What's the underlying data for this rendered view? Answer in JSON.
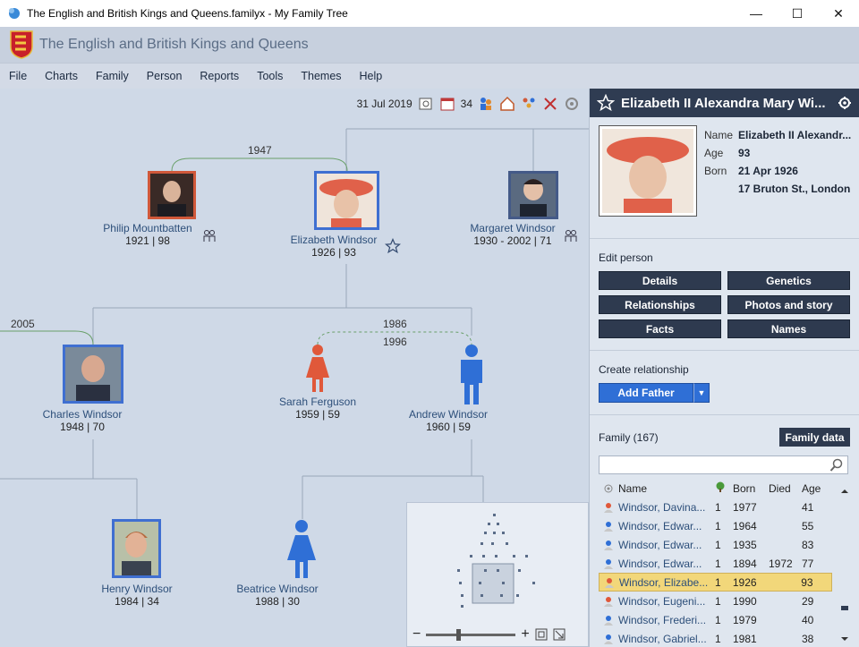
{
  "window": {
    "title": "The English and British Kings and Queens.familyx - My Family Tree",
    "minimize": "—",
    "maximize": "☐",
    "close": "✕"
  },
  "app": {
    "header_title": "The English and British Kings and Queens"
  },
  "menu": [
    "File",
    "Charts",
    "Family",
    "Person",
    "Reports",
    "Tools",
    "Themes",
    "Help"
  ],
  "toolbar": {
    "date": "31 Jul 2019",
    "count": "34"
  },
  "tree": {
    "years": {
      "philip_elizabeth": "1947",
      "charles_left": "2005",
      "andrew_sarah_married": "1986",
      "andrew_sarah_divorced": "1996"
    },
    "people": {
      "philip": {
        "name": "Philip Mountbatten",
        "years": "1921 | 98"
      },
      "elizabeth": {
        "name": "Elizabeth Windsor",
        "years": "1926 | 93"
      },
      "margaret": {
        "name": "Margaret Windsor",
        "years": "1930 - 2002 | 71"
      },
      "charles": {
        "name": "Charles Windsor",
        "years": "1948 | 70"
      },
      "sarah": {
        "name": "Sarah Ferguson",
        "years": "1959 | 59"
      },
      "andrew": {
        "name": "Andrew Windsor",
        "years": "1960 | 59"
      },
      "henry": {
        "name": "Henry Windsor",
        "years": "1984 | 34"
      },
      "beatrice": {
        "name": "Beatrice Windsor",
        "years": "1988 | 30"
      }
    }
  },
  "panel": {
    "person_name": "Elizabeth II Alexandra Mary Wi...",
    "fields": [
      {
        "label": "Name",
        "value": "Elizabeth II Alexandr..."
      },
      {
        "label": "Age",
        "value": "93"
      },
      {
        "label": "Born",
        "value": "21 Apr 1926"
      },
      {
        "label": "",
        "value": "17 Bruton St., London"
      }
    ],
    "edit_heading": "Edit person",
    "edit_buttons": [
      "Details",
      "Genetics",
      "Relationships",
      "Photos and story",
      "Facts",
      "Names"
    ],
    "create_heading": "Create relationship",
    "add_father": "Add Father",
    "family_heading": "Family (167)",
    "family_data": "Family data",
    "search_placeholder": "",
    "columns": [
      "Name",
      "",
      "Born",
      "Died",
      "Age"
    ],
    "rows": [
      {
        "sex": "f",
        "name": "Windsor, Davina...",
        "gen": "1",
        "born": "1977",
        "died": "",
        "age": "41",
        "selected": false
      },
      {
        "sex": "m",
        "name": "Windsor, Edwar...",
        "gen": "1",
        "born": "1964",
        "died": "",
        "age": "55",
        "selected": false
      },
      {
        "sex": "m",
        "name": "Windsor, Edwar...",
        "gen": "1",
        "born": "1935",
        "died": "",
        "age": "83",
        "selected": false
      },
      {
        "sex": "m",
        "name": "Windsor, Edwar...",
        "gen": "1",
        "born": "1894",
        "died": "1972",
        "age": "77",
        "selected": false
      },
      {
        "sex": "f",
        "name": "Windsor, Elizabe...",
        "gen": "1",
        "born": "1926",
        "died": "",
        "age": "93",
        "selected": true
      },
      {
        "sex": "f",
        "name": "Windsor, Eugeni...",
        "gen": "1",
        "born": "1990",
        "died": "",
        "age": "29",
        "selected": false
      },
      {
        "sex": "m",
        "name": "Windsor, Frederi...",
        "gen": "1",
        "born": "1979",
        "died": "",
        "age": "40",
        "selected": false
      },
      {
        "sex": "m",
        "name": "Windsor, Gabriel...",
        "gen": "1",
        "born": "1981",
        "died": "",
        "age": "38",
        "selected": false
      }
    ]
  },
  "colors": {
    "male": "#2f6fd6",
    "female": "#e0583a",
    "accent": "#2f3c52",
    "selected_row": "#f2d77a"
  }
}
